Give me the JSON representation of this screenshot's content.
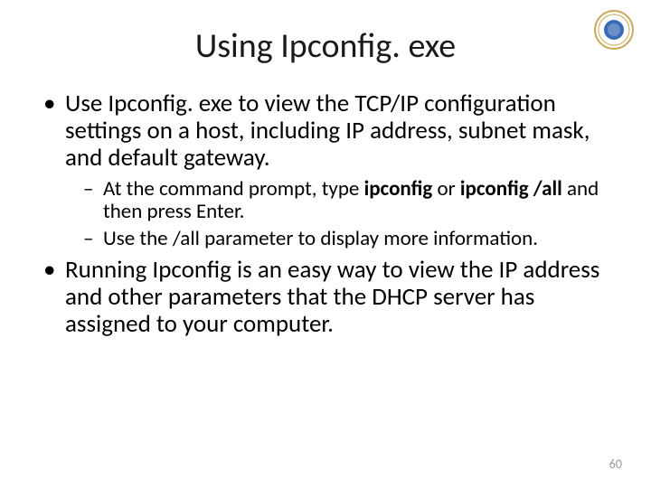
{
  "title": "Using Ipconfig. exe",
  "logo_name": "institution-seal-icon",
  "bullets": {
    "b1": "Use Ipconfig. exe to view the TCP/IP configuration settings on a host, including IP address, subnet mask, and default gateway.",
    "b1_sub1_pre": "At the command prompt, type ",
    "b1_sub1_bold1": "ipconfig",
    "b1_sub1_mid": " or ",
    "b1_sub1_bold2": "ipconfig /all",
    "b1_sub1_post": " and then press Enter.",
    "b1_sub2": "Use the /all parameter to display more information.",
    "b2": "Running Ipconfig is an easy way to view the IP address and other parameters that the DHCP server has assigned to your computer."
  },
  "page_number": "60"
}
